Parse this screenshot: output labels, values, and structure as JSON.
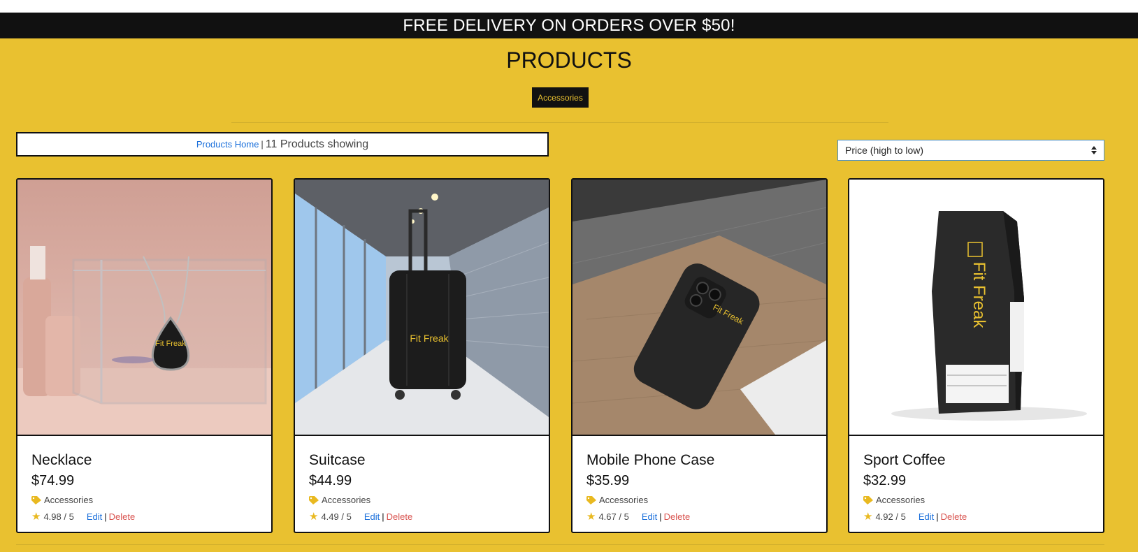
{
  "banner": {
    "text": "FREE DELIVERY ON ORDERS OVER $50!"
  },
  "page": {
    "title": "PRODUCTS"
  },
  "category_filter": {
    "label": "Accessories"
  },
  "summary": {
    "home_link": "Products Home",
    "separator": "|",
    "count_text": "11 Products showing"
  },
  "sort": {
    "selected": "Price (high to low)"
  },
  "products": [
    {
      "name": "Necklace",
      "price": "$74.99",
      "category": "Accessories",
      "rating": "4.98 / 5",
      "edit": "Edit",
      "sep": "|",
      "delete": "Delete",
      "brand": "Fit Freak"
    },
    {
      "name": "Suitcase",
      "price": "$44.99",
      "category": "Accessories",
      "rating": "4.49 / 5",
      "edit": "Edit",
      "sep": "|",
      "delete": "Delete",
      "brand": "Fit Freak"
    },
    {
      "name": "Mobile Phone Case",
      "price": "$35.99",
      "category": "Accessories",
      "rating": "4.67 / 5",
      "edit": "Edit",
      "sep": "|",
      "delete": "Delete",
      "brand": "Fit Freak"
    },
    {
      "name": "Sport Coffee",
      "price": "$32.99",
      "category": "Accessories",
      "rating": "4.92 / 5",
      "edit": "Edit",
      "sep": "|",
      "delete": "Delete",
      "brand": "Fit Freak"
    }
  ],
  "colors": {
    "accent": "#e9c130",
    "dark": "#111111",
    "link": "#1a6fdb",
    "danger": "#d9534f"
  },
  "icons": {
    "category": "tag-icon",
    "rating": "star-icon",
    "sort": "sort-arrows-icon"
  }
}
